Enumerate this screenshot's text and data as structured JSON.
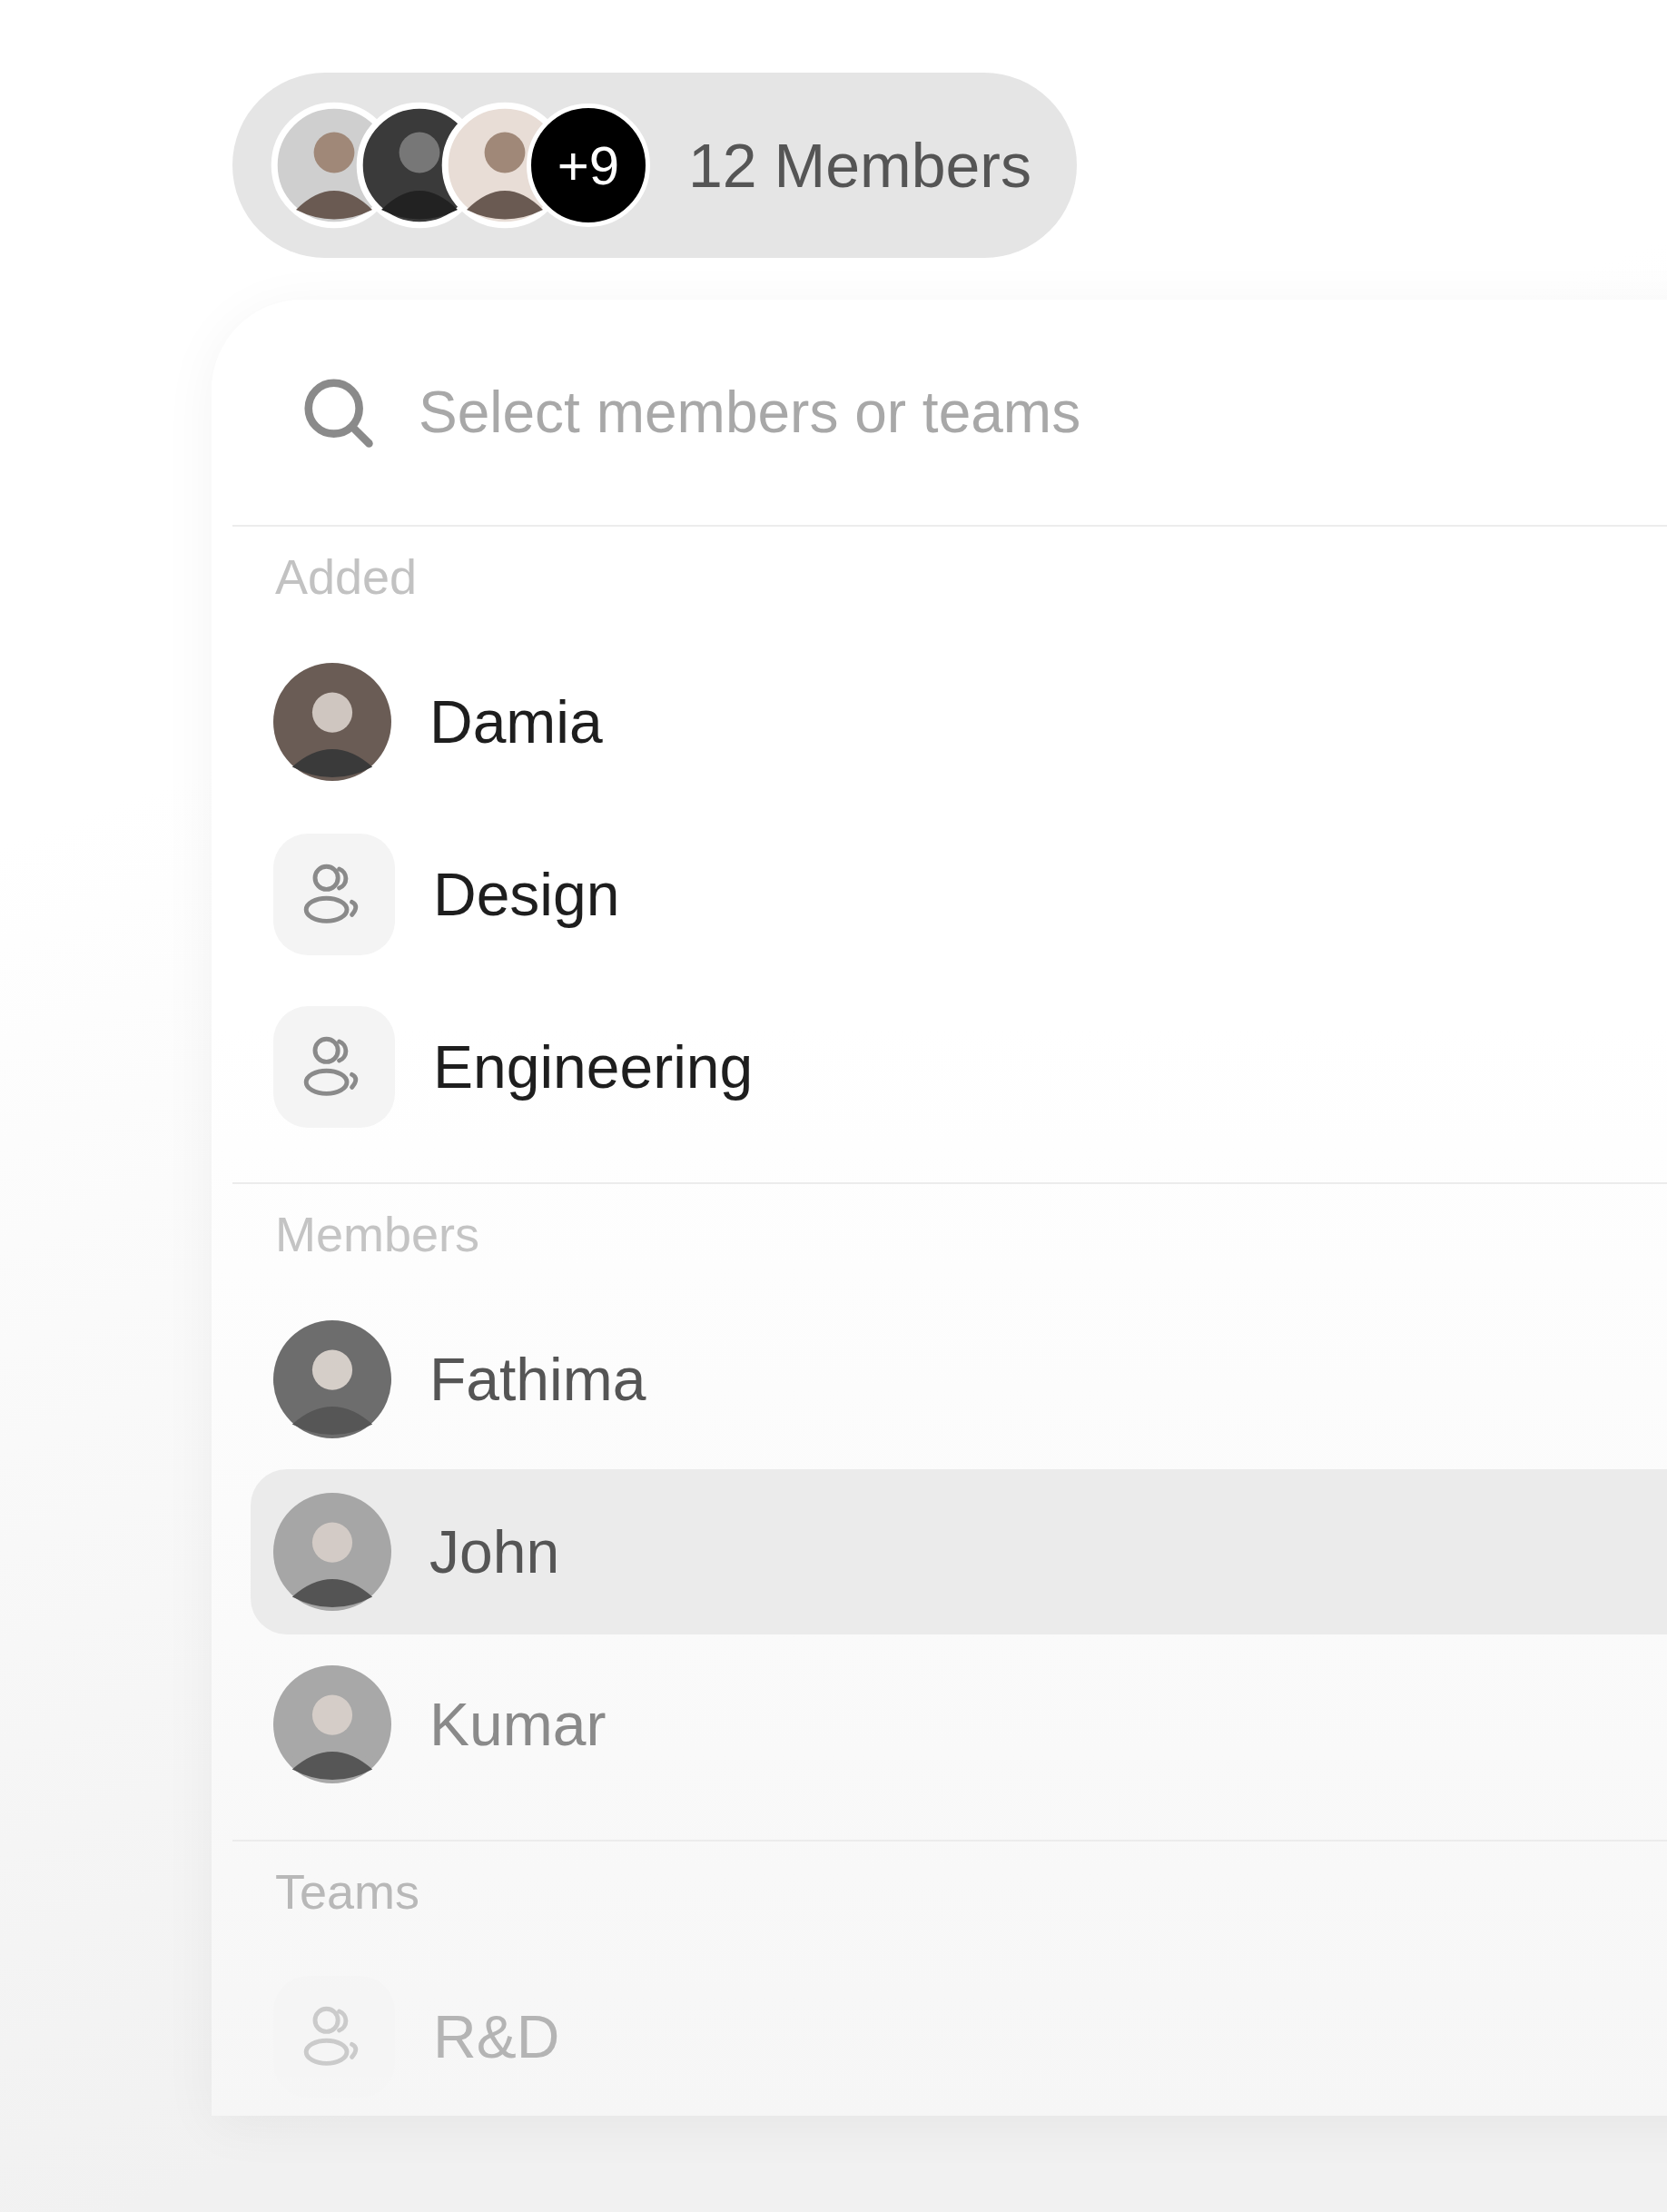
{
  "members_pill": {
    "avatars": [
      {
        "kind": "photo"
      },
      {
        "kind": "photo"
      },
      {
        "kind": "photo"
      }
    ],
    "overflow_count": "+9",
    "label": "12 Members"
  },
  "search": {
    "placeholder": "Select members or teams"
  },
  "sections": [
    {
      "title": "Added",
      "items": [
        {
          "kind": "person",
          "name": "Damia",
          "selected": false
        },
        {
          "kind": "team",
          "name": "Design",
          "selected": false
        },
        {
          "kind": "team",
          "name": "Engineering",
          "selected": false
        }
      ]
    },
    {
      "title": "Members",
      "items": [
        {
          "kind": "person",
          "name": "Fathima",
          "selected": false
        },
        {
          "kind": "person",
          "name": "John",
          "selected": true
        },
        {
          "kind": "person",
          "name": "Kumar",
          "selected": false
        }
      ]
    },
    {
      "title": "Teams",
      "items": [
        {
          "kind": "team",
          "name": "R&D",
          "selected": false
        }
      ]
    }
  ]
}
